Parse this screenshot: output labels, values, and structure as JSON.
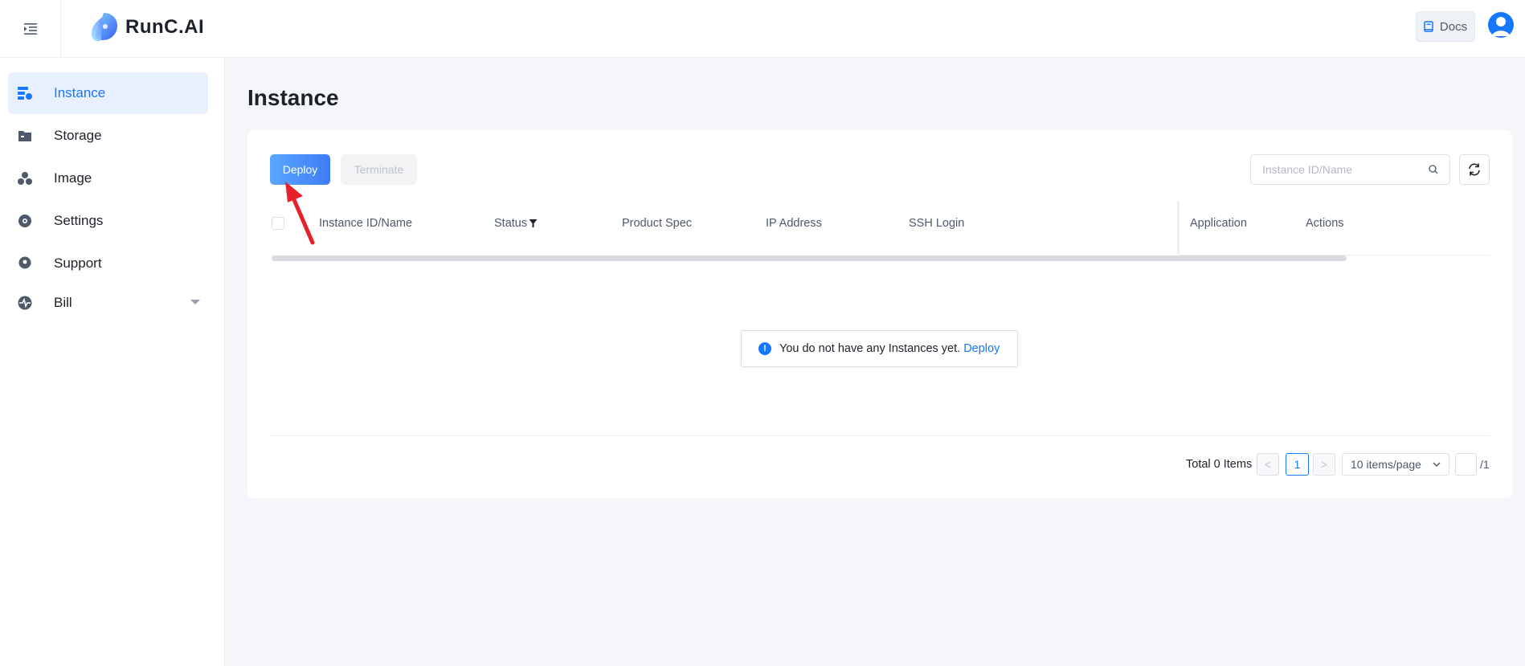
{
  "header": {
    "brand": "RunC.AI",
    "docs_label": "Docs"
  },
  "sidebar": {
    "items": [
      {
        "label": "Instance",
        "icon": "server-icon",
        "active": true
      },
      {
        "label": "Storage",
        "icon": "folder-icon",
        "active": false
      },
      {
        "label": "Image",
        "icon": "cubes-icon",
        "active": false
      },
      {
        "label": "Settings",
        "icon": "gear-icon",
        "active": false
      },
      {
        "label": "Support",
        "icon": "location-pin-icon",
        "active": false
      },
      {
        "label": "Bill",
        "icon": "pulse-icon",
        "active": false,
        "expandable": true
      }
    ]
  },
  "main": {
    "title": "Instance",
    "toolbar": {
      "deploy_label": "Deploy",
      "terminate_label": "Terminate",
      "search_placeholder": "Instance ID/Name"
    },
    "table": {
      "columns": [
        "Instance ID/Name",
        "Status",
        "Product Spec",
        "IP Address",
        "SSH Login",
        "Application",
        "Actions"
      ],
      "rows": []
    },
    "empty": {
      "message": "You do not have any Instances yet.",
      "link": "Deploy"
    },
    "pagination": {
      "total_text": "Total 0 Items",
      "prev": "<",
      "current_page": "1",
      "next": ">",
      "page_size": "10 items/page",
      "jump_total": "/1"
    }
  },
  "colors": {
    "accent": "#1677ff",
    "annotation_arrow": "#e8202a"
  }
}
